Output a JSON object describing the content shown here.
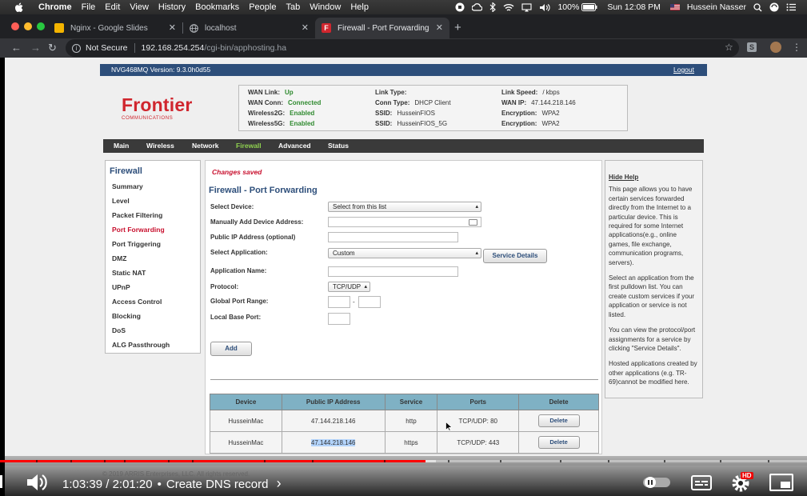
{
  "menubar": {
    "app": "Chrome",
    "items": [
      "File",
      "Edit",
      "View",
      "History",
      "Bookmarks",
      "People",
      "Tab",
      "Window",
      "Help"
    ],
    "battery": "100%",
    "clock": "Sun 12:08 PM",
    "user": "Hussein Nasser"
  },
  "tabs": [
    {
      "title": "Nginx - Google Slides",
      "icon": "slides-icon",
      "close": "✕"
    },
    {
      "title": "localhost",
      "icon": "globe-icon",
      "close": "✕"
    },
    {
      "title": "Firewall - Port Forwarding",
      "icon": "frontier-icon",
      "close": "✕",
      "favicon_text": "F"
    }
  ],
  "newtab": "+",
  "toolbar": {
    "back": "←",
    "forward": "→",
    "reload": "↻",
    "not_secure": "Not Secure",
    "url_host": "192.168.254.254",
    "url_path": "/cgi-bin/apphosting.ha",
    "star": "☆",
    "ext": "S",
    "menu": "⋮"
  },
  "router": {
    "version": "NVG468MQ Version: 9.3.0h0d55",
    "logout": "Logout",
    "logo_main": "Frontier",
    "logo_sub": "COMMUNICATIONS",
    "status": {
      "col1": [
        {
          "label": "WAN Link:",
          "value": "Up"
        },
        {
          "label": "WAN Conn:",
          "value": "Connected"
        },
        {
          "label": "Wireless2G:",
          "value": "Enabled"
        },
        {
          "label": "Wireless5G:",
          "value": "Enabled"
        }
      ],
      "col2": [
        {
          "label": "Link Type:",
          "value": ""
        },
        {
          "label": "Conn Type:",
          "value": "DHCP Client"
        },
        {
          "label": "SSID:",
          "value": "HusseinFIOS"
        },
        {
          "label": "SSID:",
          "value": "HusseinFIOS_5G"
        }
      ],
      "col3": [
        {
          "label": "Link Speed:",
          "value": "/ kbps"
        },
        {
          "label": "WAN IP:",
          "value": "47.144.218.146"
        },
        {
          "label": "Encryption:",
          "value": "WPA2"
        },
        {
          "label": "Encryption:",
          "value": "WPA2"
        }
      ]
    },
    "mainnav": [
      "Main",
      "Wireless",
      "Network",
      "Firewall",
      "Advanced",
      "Status"
    ],
    "mainnav_active": "Firewall",
    "sidebar": {
      "heading": "Firewall",
      "items": [
        "Summary",
        "Level",
        "Packet Filtering",
        "Port Forwarding",
        "Port Triggering",
        "DMZ",
        "Static NAT",
        "UPnP",
        "Access Control",
        "Blocking",
        "DoS",
        "ALG Passthrough"
      ],
      "active": "Port Forwarding"
    },
    "form": {
      "saved": "Changes saved",
      "title": "Firewall - Port Forwarding",
      "select_device_label": "Select Device:",
      "select_device_value": "Select from this list",
      "manual_device_label": "Manually Add Device Address:",
      "public_ip_label": "Public IP Address (optional)",
      "select_app_label": "Select Application:",
      "select_app_value": "Custom",
      "service_details": "Service Details",
      "app_name_label": "Application Name:",
      "protocol_label": "Protocol:",
      "protocol_value": "TCP/UDP",
      "global_port_label": "Global Port Range:",
      "range_dash": "-",
      "local_port_label": "Local Base Port:",
      "add": "Add"
    },
    "table": {
      "headers": [
        "Device",
        "Public IP Address",
        "Service",
        "Ports",
        "Delete"
      ],
      "rows": [
        {
          "device": "HusseinMac",
          "ip": "47.144.218.146",
          "service": "http",
          "ports": "TCP/UDP: 80",
          "delete": "Delete"
        },
        {
          "device": "HusseinMac",
          "ip": "47.144.218.146",
          "service": "https",
          "ports": "TCP/UDP: 443",
          "delete": "Delete"
        }
      ]
    },
    "help": {
      "heading": "Hide Help",
      "p1": "This page allows you to have certain services forwarded directly from the Internet to a particular device. This is required for some Internet applications(e.g., online games, file exchange, communication programs, servers).",
      "p2": "Select an application from the first pulldown list. You can create custom services if your application or service is not listed.",
      "p3": "You can view the protocol/port assignments for a service by clicking \"Service Details\".",
      "p4": "Hosted applications created by other applications (e.g. TR-69)cannot be modified here."
    }
  },
  "video": {
    "current": "1:03:39",
    "duration": "2:01:20",
    "chapter": "Create DNS record",
    "chapter_arrow": "›",
    "separator": "•",
    "progress_played": 0.527,
    "progress_loaded": 0.54,
    "hd": "HD",
    "copyright_partial": "© 2019 ARRIS Enterprises, LLC. All rights reserved."
  }
}
